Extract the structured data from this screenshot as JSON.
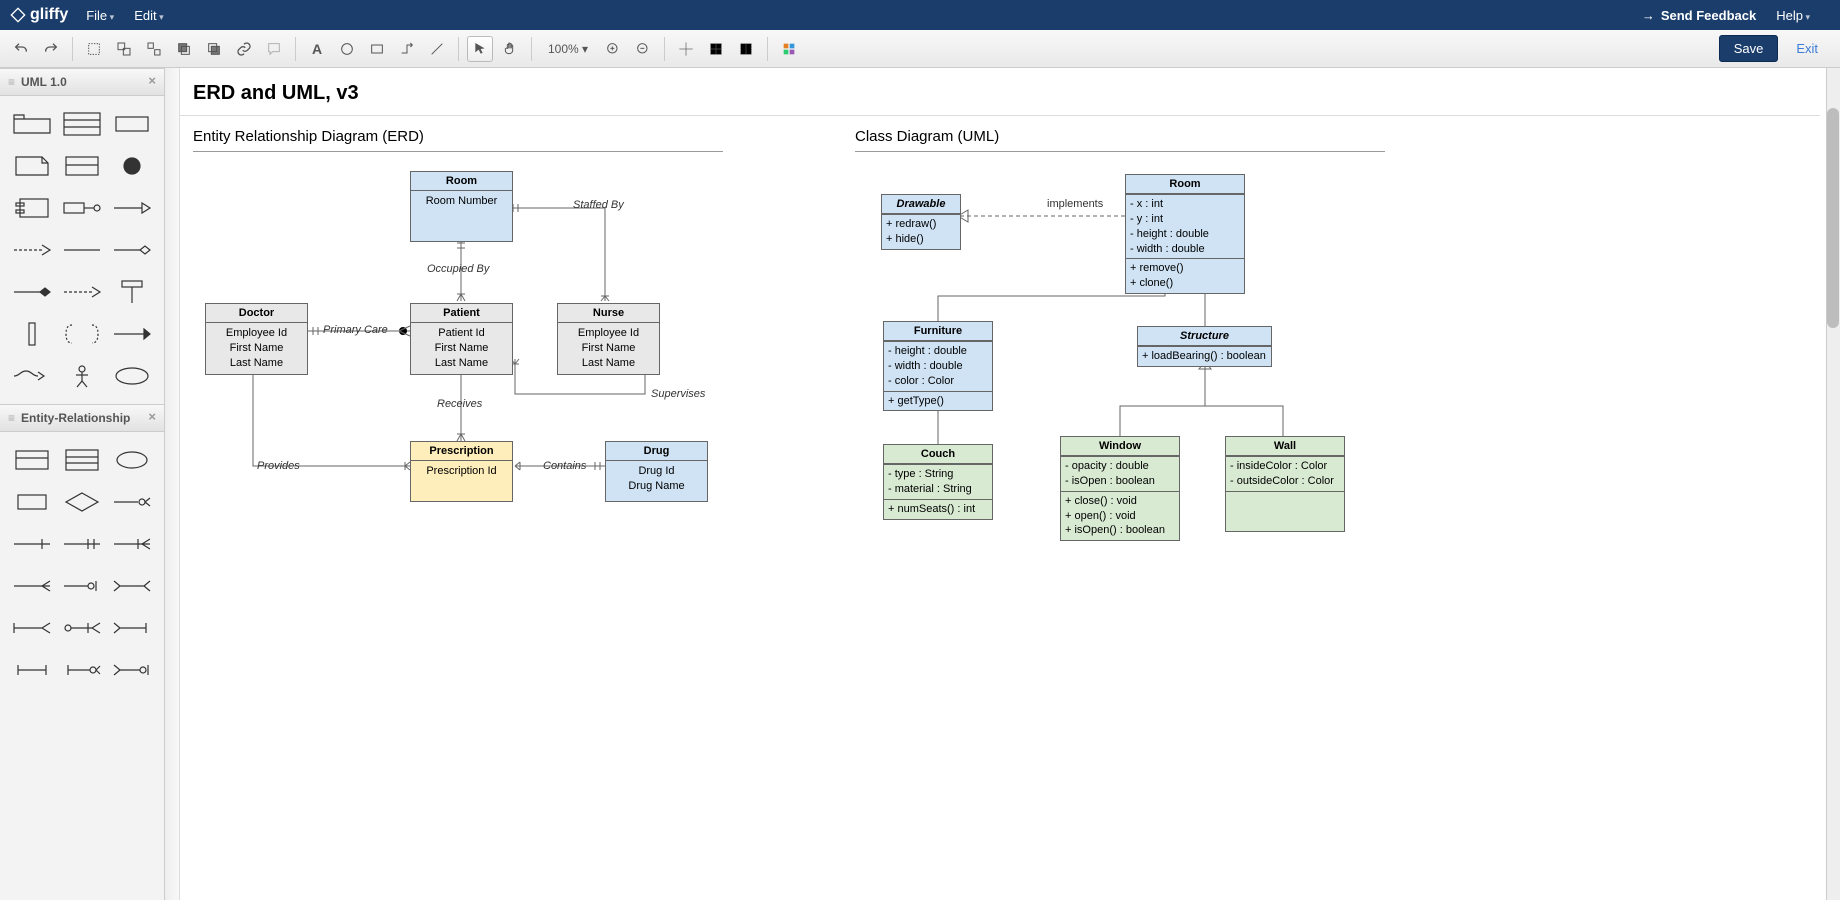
{
  "topnav": {
    "brand": "gliffy",
    "menus": [
      "File",
      "Edit"
    ],
    "feedback": "Send Feedback",
    "help": "Help"
  },
  "toolbar": {
    "zoom": "100%",
    "save": "Save",
    "exit": "Exit"
  },
  "sidebar": {
    "panels": [
      {
        "title": "UML 1.0"
      },
      {
        "title": "Entity-Relationship"
      }
    ]
  },
  "document": {
    "title": "ERD and UML, v3",
    "sections": {
      "erd": "Entity Relationship Diagram (ERD)",
      "uml": "Class Diagram (UML)"
    }
  },
  "erd": {
    "room": {
      "name": "Room",
      "attrs": "Room Number"
    },
    "doctor": {
      "name": "Doctor",
      "attrs": "Employee Id\nFirst Name\nLast Name"
    },
    "patient": {
      "name": "Patient",
      "attrs": "Patient Id\nFirst Name\nLast Name"
    },
    "nurse": {
      "name": "Nurse",
      "attrs": "Employee Id\nFirst Name\nLast Name"
    },
    "prescription": {
      "name": "Prescription",
      "attrs": "Prescription Id"
    },
    "drug": {
      "name": "Drug",
      "attrs": "Drug Id\nDrug Name"
    },
    "labels": {
      "staffedBy": "Staffed By",
      "occupiedBy": "Occupied By",
      "primaryCare": "Primary Care",
      "supervises": "Supervises",
      "receives": "Receives",
      "provides": "Provides",
      "contains": "Contains"
    }
  },
  "uml": {
    "drawable": {
      "name": "Drawable",
      "ops": "+ redraw()\n+ hide()"
    },
    "room": {
      "name": "Room",
      "attrs": "- x : int\n- y : int\n- height : double\n- width : double",
      "ops": "+ remove()\n+ clone()"
    },
    "furniture": {
      "name": "Furniture",
      "attrs": "- height : double\n- width : double\n- color : Color",
      "ops": "+ getType()"
    },
    "structure": {
      "name": "Structure",
      "ops": "+ loadBearing() : boolean"
    },
    "couch": {
      "name": "Couch",
      "attrs": "- type : String\n- material : String",
      "ops": "+ numSeats() : int"
    },
    "window": {
      "name": "Window",
      "attrs": "- opacity : double\n- isOpen : boolean",
      "ops": "+ close() : void\n+ open() : void\n+ isOpen() : boolean"
    },
    "wall": {
      "name": "Wall",
      "attrs": "- insideColor : Color\n- outsideColor : Color"
    },
    "labels": {
      "implements": "implements"
    }
  }
}
